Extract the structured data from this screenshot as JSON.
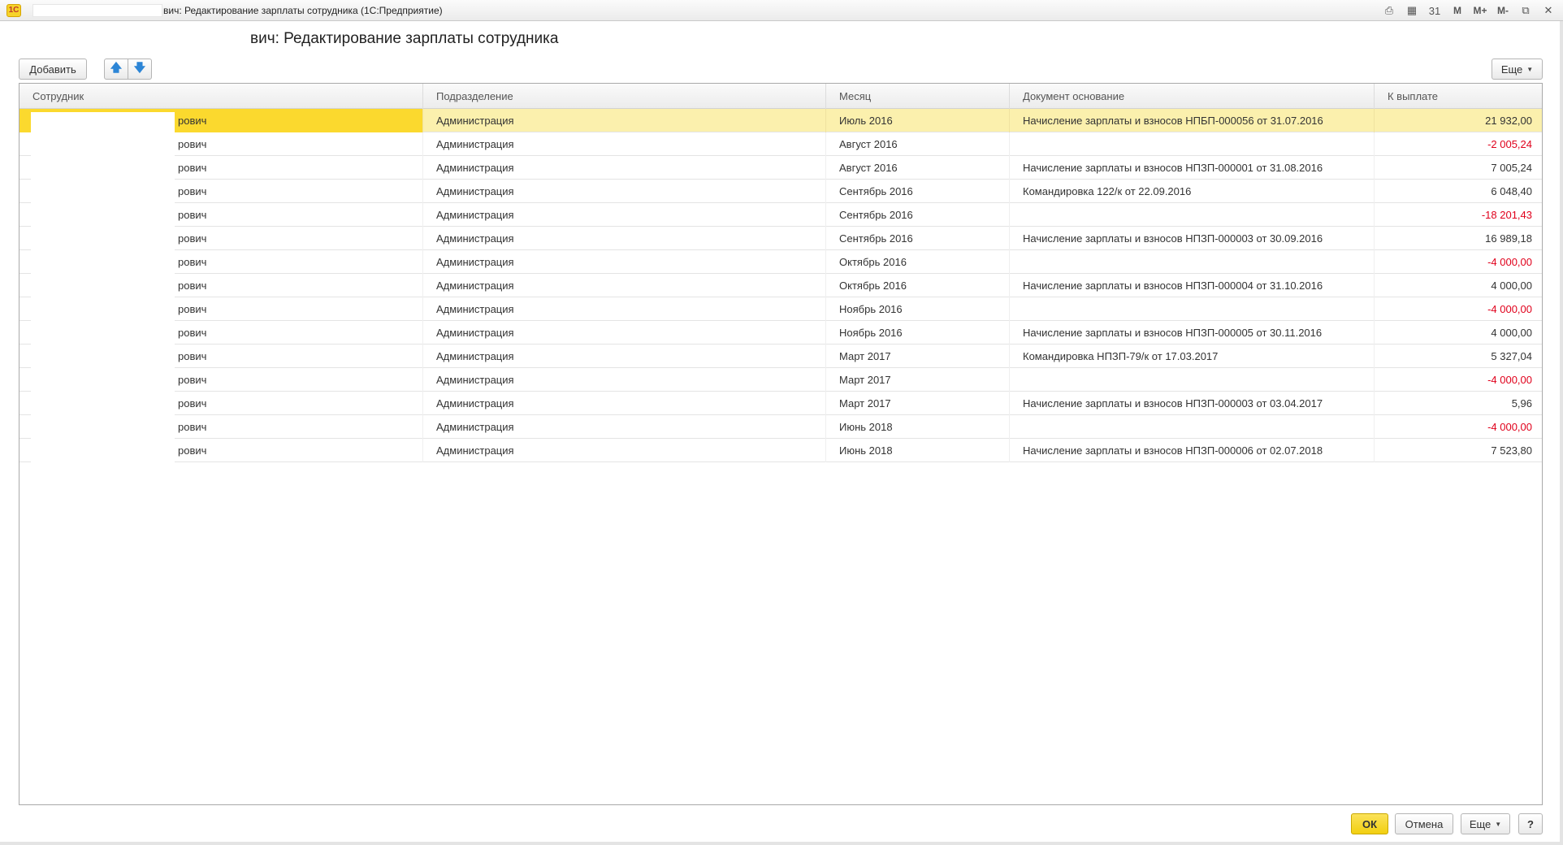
{
  "window": {
    "title": "вич: Редактирование зарплаты сотрудника  (1С:Предприятие)",
    "logo_text": "1С",
    "icons": [
      "print-icon",
      "calculator-icon",
      "calendar-icon"
    ],
    "memory_buttons": [
      "M",
      "M+",
      "M-"
    ],
    "calendar_day": "31"
  },
  "form": {
    "title": "вич: Редактирование зарплаты сотрудника"
  },
  "toolbar": {
    "add_label": "Добавить",
    "up_symbol": "🡅",
    "down_symbol": "🡇",
    "more_label": "Еще"
  },
  "table": {
    "columns": [
      "Сотрудник",
      "Подразделение",
      "Месяц",
      "Документ основание",
      "К выплате"
    ],
    "rows": [
      {
        "employee": "рович",
        "department": "Администрация",
        "month": "Июль 2016",
        "document": "Начисление зарплаты и взносов НПБП-000056 от 31.07.2016",
        "amount": "21 932,00",
        "negative": false
      },
      {
        "employee": "рович",
        "department": "Администрация",
        "month": "Август 2016",
        "document": "",
        "amount": "-2 005,24",
        "negative": true
      },
      {
        "employee": "рович",
        "department": "Администрация",
        "month": "Август 2016",
        "document": "Начисление зарплаты и взносов НПЗП-000001 от 31.08.2016",
        "amount": "7 005,24",
        "negative": false
      },
      {
        "employee": "рович",
        "department": "Администрация",
        "month": "Сентябрь 2016",
        "document": "Командировка 122/к от 22.09.2016",
        "amount": "6 048,40",
        "negative": false
      },
      {
        "employee": "рович",
        "department": "Администрация",
        "month": "Сентябрь 2016",
        "document": "",
        "amount": "-18 201,43",
        "negative": true
      },
      {
        "employee": "рович",
        "department": "Администрация",
        "month": "Сентябрь 2016",
        "document": "Начисление зарплаты и взносов НПЗП-000003 от 30.09.2016",
        "amount": "16 989,18",
        "negative": false
      },
      {
        "employee": "рович",
        "department": "Администрация",
        "month": "Октябрь 2016",
        "document": "",
        "amount": "-4 000,00",
        "negative": true
      },
      {
        "employee": "рович",
        "department": "Администрация",
        "month": "Октябрь 2016",
        "document": "Начисление зарплаты и взносов НПЗП-000004 от 31.10.2016",
        "amount": "4 000,00",
        "negative": false
      },
      {
        "employee": "рович",
        "department": "Администрация",
        "month": "Ноябрь 2016",
        "document": "",
        "amount": "-4 000,00",
        "negative": true
      },
      {
        "employee": "рович",
        "department": "Администрация",
        "month": "Ноябрь 2016",
        "document": "Начисление зарплаты и взносов НПЗП-000005 от 30.11.2016",
        "amount": "4 000,00",
        "negative": false
      },
      {
        "employee": "рович",
        "department": "Администрация",
        "month": "Март 2017",
        "document": "Командировка НПЗП-79/к от 17.03.2017",
        "amount": "5 327,04",
        "negative": false
      },
      {
        "employee": "рович",
        "department": "Администрация",
        "month": "Март 2017",
        "document": "",
        "amount": "-4 000,00",
        "negative": true
      },
      {
        "employee": "рович",
        "department": "Администрация",
        "month": "Март 2017",
        "document": "Начисление зарплаты и взносов НПЗП-000003 от 03.04.2017",
        "amount": "5,96",
        "negative": false
      },
      {
        "employee": "рович",
        "department": "Администрация",
        "month": "Июнь 2018",
        "document": "",
        "amount": "-4 000,00",
        "negative": true
      },
      {
        "employee": "рович",
        "department": "Администрация",
        "month": "Июнь 2018",
        "document": "Начисление зарплаты и взносов НПЗП-000006 от 02.07.2018",
        "amount": "7 523,80",
        "negative": false
      }
    ]
  },
  "footer": {
    "ok_label": "ОК",
    "cancel_label": "Отмена",
    "more_label": "Еще",
    "help_label": "?"
  },
  "colors": {
    "selected_row": "#fbf0ad",
    "selected_cell": "#fbd92e",
    "negative_amount": "#e0001b",
    "ok_button": "#f2cf10"
  }
}
